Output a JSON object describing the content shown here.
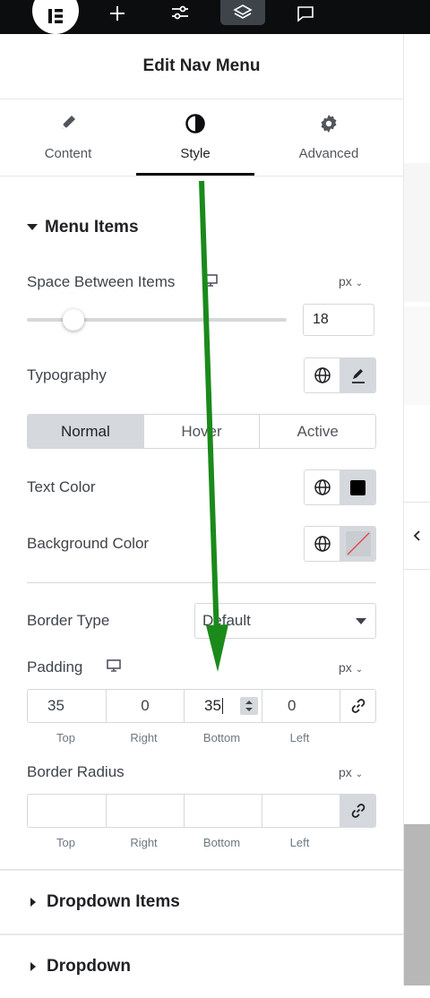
{
  "topbar": {
    "icons": [
      "elementor-logo-icon",
      "add-icon",
      "settings-sliders-icon",
      "layers-icon",
      "chat-icon"
    ]
  },
  "header": {
    "title": "Edit Nav Menu"
  },
  "tabs": [
    {
      "label": "Content",
      "icon": "pencil-icon"
    },
    {
      "label": "Style",
      "icon": "half-circle-icon",
      "active": true
    },
    {
      "label": "Advanced",
      "icon": "gear-icon"
    }
  ],
  "menu_items": {
    "title": "Menu Items",
    "space_between": {
      "label": "Space Between Items",
      "unit": "px",
      "value": "18",
      "slider_fraction": 0.18
    },
    "typography": {
      "label": "Typography"
    },
    "states": [
      "Normal",
      "Hover",
      "Active"
    ],
    "active_state": "Normal",
    "text_color": {
      "label": "Text Color",
      "swatch": "#000000"
    },
    "background_color": {
      "label": "Background Color"
    },
    "border_type": {
      "label": "Border Type",
      "value": "Default"
    },
    "padding": {
      "label": "Padding",
      "unit": "px",
      "values": [
        "35",
        "0",
        "35",
        "0"
      ],
      "sides": [
        "Top",
        "Right",
        "Bottom",
        "Left"
      ]
    },
    "border_radius": {
      "label": "Border Radius",
      "unit": "px",
      "values": [
        "",
        "",
        "",
        ""
      ],
      "sides": [
        "Top",
        "Right",
        "Bottom",
        "Left"
      ]
    }
  },
  "sections": [
    {
      "title": "Dropdown Items"
    },
    {
      "title": "Dropdown"
    }
  ],
  "colors": {
    "accent_arrow": "#1a8a1a",
    "control_bg": "#d5d8dc",
    "topbar": "#0c0d0e"
  }
}
